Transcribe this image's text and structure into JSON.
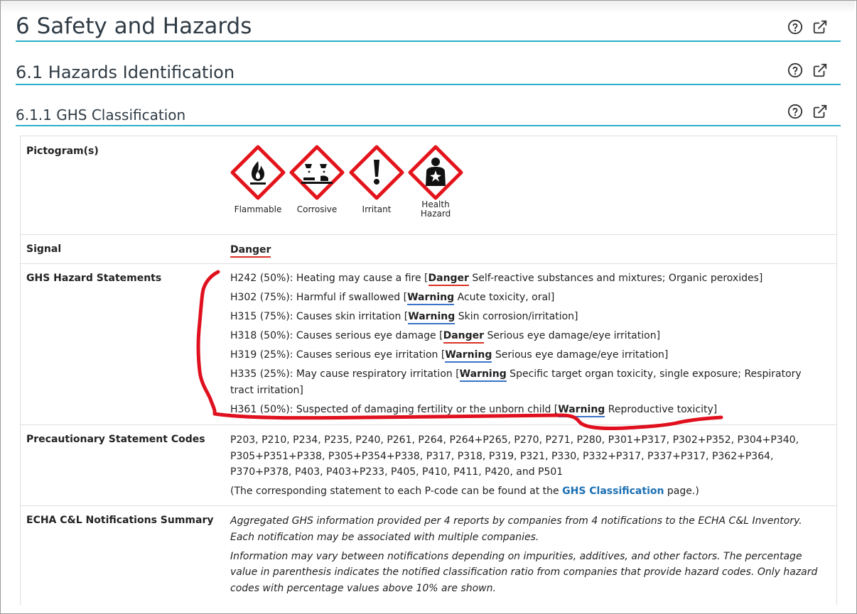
{
  "headings": {
    "h1": "6 Safety and Hazards",
    "h2": "6.1 Hazards Identification",
    "h3": "6.1.1 GHS Classification"
  },
  "rows": {
    "pictograms_label": "Pictogram(s)",
    "pictograms": [
      {
        "caption": "Flammable",
        "icon": "flame-icon"
      },
      {
        "caption": "Corrosive",
        "icon": "corrosion-icon"
      },
      {
        "caption": "Irritant",
        "icon": "exclamation-icon"
      },
      {
        "caption": "Health\nHazard",
        "icon": "health-hazard-icon"
      }
    ],
    "signal_label": "Signal",
    "signal_value": "Danger",
    "hazard_label": "GHS Hazard Statements",
    "hazard_statements": [
      {
        "text": "H242 (50%): Heating may cause a fire [",
        "signal": "Danger",
        "tail": " Self-reactive substances and mixtures; Organic peroxides]"
      },
      {
        "text": "H302 (75%): Harmful if swallowed [",
        "signal": "Warning",
        "tail": " Acute toxicity, oral]"
      },
      {
        "text": "H315 (75%): Causes skin irritation [",
        "signal": "Warning",
        "tail": " Skin corrosion/irritation]"
      },
      {
        "text": "H318 (50%): Causes serious eye damage [",
        "signal": "Danger",
        "tail": " Serious eye damage/eye irritation]"
      },
      {
        "text": "H319 (25%): Causes serious eye irritation [",
        "signal": "Warning",
        "tail": " Serious eye damage/eye irritation]"
      },
      {
        "text": "H335 (25%): May cause respiratory irritation [",
        "signal": "Warning",
        "tail": " Specific target organ toxicity, single exposure; Respiratory tract irritation]"
      },
      {
        "text": "H361 (50%): Suspected of damaging fertility or the unborn child [",
        "signal": "Warning",
        "tail": " Reproductive toxicity]"
      }
    ],
    "precaution_label": "Precautionary Statement Codes",
    "precaution_codes": "P203, P210, P234, P235, P240, P261, P264, P264+P265, P270, P271, P280, P301+P317, P302+P352, P304+P340, P305+P351+P338, P305+P354+P338, P317, P318, P319, P321, P330, P332+P317, P337+P317, P362+P364, P370+P378, P403, P403+P233, P405, P410, P411, P420, and P501",
    "precaution_note_prefix": "(The corresponding statement to each P-code can be found at the ",
    "precaution_link": "GHS Classification",
    "precaution_note_suffix": " page.)",
    "echa_label": "ECHA C&L Notifications Summary",
    "echa_p1": "Aggregated GHS information provided per 4 reports by companies from 4 notifications to the ECHA C&L Inventory. Each notification may be associated with multiple companies.",
    "echa_p2": "Information may vary between notifications depending on impurities, additives, and other factors. The percentage value in parenthesis indicates the notified classification ratio from companies that provide hazard codes. Only hazard codes with percentage values above 10% are shown."
  },
  "colors": {
    "accent": "#2ab0c9",
    "danger": "#d93025",
    "warning": "#3a73c8",
    "link": "#1a6fb3",
    "ghs_red": "#e3141b",
    "annotation_red": "#e0101e"
  }
}
